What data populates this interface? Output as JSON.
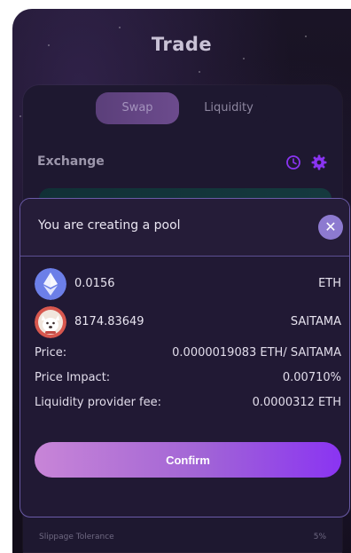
{
  "header": {
    "title": "Trade"
  },
  "tabs": {
    "swap": "Swap",
    "liquidity": "Liquidity"
  },
  "exchange": {
    "label": "Exchange"
  },
  "slippage": {
    "label": "Slippage Tolerance",
    "value": "5%"
  },
  "modal": {
    "title": "You are creating a pool",
    "close_symbol": "✕",
    "tokens": [
      {
        "amount": "0.0156",
        "symbol": "ETH",
        "icon": "eth-icon"
      },
      {
        "amount": "8174.83649",
        "symbol": "SAITAMA",
        "icon": "saitama-icon"
      }
    ],
    "details": [
      {
        "label": "Price:",
        "value": "0.0000019083 ETH/ SAITAMA"
      },
      {
        "label": "Price Impact:",
        "value": "0.00710%"
      },
      {
        "label": "Liquidity provider fee:",
        "value": "0.0000312 ETH"
      }
    ],
    "confirm_label": "Confirm"
  },
  "colors": {
    "accent": "#8a34f2",
    "modal_border": "#6b5ba8",
    "close_button": "#8d7ad0",
    "eth_blue": "#6c7fe8"
  }
}
